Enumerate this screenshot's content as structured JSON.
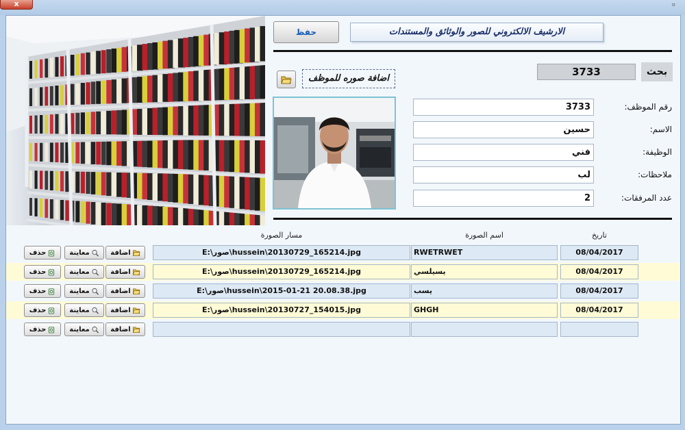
{
  "window": {
    "close_label": "x",
    "restore_label": "▫"
  },
  "header": {
    "save_label": "حفظ",
    "app_title": "الارشيف الالكتروني للصور والوثائق والمستندات"
  },
  "search": {
    "value": "3733",
    "label": "بحث"
  },
  "photo": {
    "add_label": "اضافة صوره للموظف"
  },
  "form": {
    "fields": [
      {
        "label": "رقم الموظف:",
        "value": "3733"
      },
      {
        "label": "الاسم:",
        "value": "حسين"
      },
      {
        "label": "الوظيفة:",
        "value": "فني"
      },
      {
        "label": "ملاحظات:",
        "value": "لب"
      },
      {
        "label": "عدد المرفقات:",
        "value": "2"
      }
    ]
  },
  "grid": {
    "columns": {
      "path": "مسار الصورة",
      "name": "اسم الصورة",
      "date": "تاريخ"
    },
    "buttons": {
      "add": "اضافة",
      "preview": "معاينة",
      "delete": "حذف"
    },
    "rows": [
      {
        "path": "E:\\صور\\hussein\\20130729_165214.jpg",
        "name": "RWETRWET",
        "date": "08/04/2017"
      },
      {
        "path": "E:\\صور\\hussein\\20130729_165214.jpg",
        "name": "يسيلسي",
        "date": "08/04/2017"
      },
      {
        "path": "E:\\صور\\hussein\\2015-01-21 20.08.38.jpg",
        "name": "يسب",
        "date": "08/04/2017"
      },
      {
        "path": "E:\\صور\\hussein\\20130727_154015.jpg",
        "name": "GHGH",
        "date": "08/04/2017"
      },
      {
        "path": "",
        "name": "",
        "date": ""
      }
    ]
  },
  "colors": {
    "accent": "#1a5fb4",
    "alt_row": "#fffbd6",
    "photo_border": "#7ec3d4"
  }
}
